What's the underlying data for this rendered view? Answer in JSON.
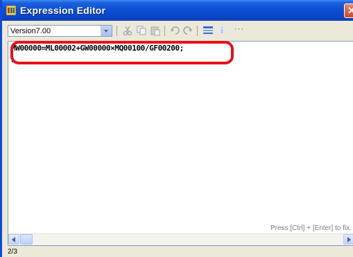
{
  "window": {
    "title": "Expression Editor"
  },
  "toolbar": {
    "version_value": "Version7.00",
    "more_label": "···"
  },
  "editor": {
    "expression": "MW00000=ML00002+GW00000×MQ00100/GF00200;",
    "hint": "Press [Ctrl] + [Enter] to fix."
  },
  "statusbar": {
    "position": "2/3"
  },
  "colors": {
    "titlebar": "#0a4bd8",
    "highlight": "#e8101a",
    "hint": "#7a7a7a"
  }
}
